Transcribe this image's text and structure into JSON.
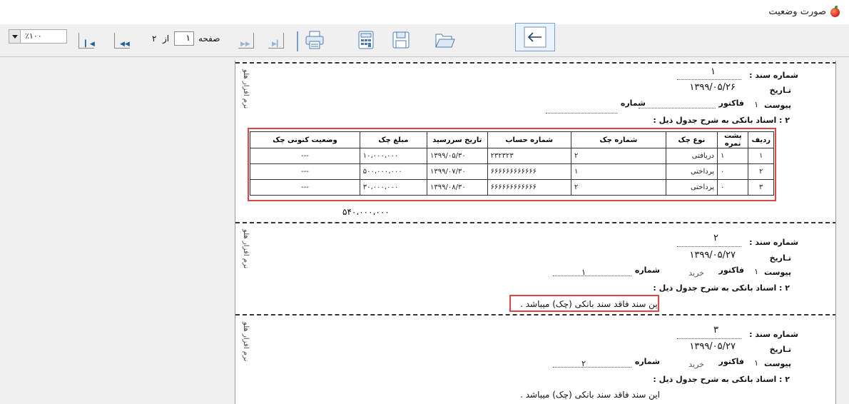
{
  "window": {
    "title": "صورت وضعیت"
  },
  "toolbar": {
    "zoom_value": "٪۱۰۰",
    "page_label": "صفحه",
    "page_current": "۱",
    "page_of": "از",
    "page_total": "۲"
  },
  "side_label": "نرم افزار هلو",
  "labels": {
    "doc_number": "شماره سند :",
    "date": "تـاریخ",
    "attachment": "پیوست",
    "number": "شماره",
    "bank_docs": "۲ : اسناد بانکی به شرح جدول ذیل :",
    "invoice": "فاکتور"
  },
  "documents": [
    {
      "number": "۱",
      "date": "۱۳۹۹/۰۵/۲۶",
      "attachment_index": "۱",
      "invoice_type": "",
      "invoice_number": ""
    },
    {
      "number": "۲",
      "date": "۱۳۹۹/۰۵/۲۷",
      "attachment_index": "۱",
      "invoice_type": "خرید",
      "invoice_number": "۱",
      "note": "این سند فاقد سند بانکی (چک) میباشد ."
    },
    {
      "number": "۳",
      "date": "۱۳۹۹/۰۵/۲۷",
      "attachment_index": "۱",
      "invoice_type": "خرید",
      "invoice_number": "۲",
      "note": "این سند فاقد سند بانکی (چک) میباشد ."
    }
  ],
  "table": {
    "headers": [
      "ردیف",
      "پشت نمره",
      "نوع چک",
      "شماره چک",
      "شماره حساب",
      "تاریخ سررسید",
      "مبلغ چک",
      "وضعیت کنونی چک"
    ],
    "rows": [
      [
        "۱",
        "۱",
        "دریافتی",
        "۲",
        "۲۳۲۳۲۳",
        "۱۳۹۹/۰۵/۳۰",
        "۱۰،۰۰۰،۰۰۰",
        "---"
      ],
      [
        "۲",
        "۰",
        "پرداختی",
        "۱",
        "۶۶۶۶۶۶۶۶۶۶۶۶",
        "۱۳۹۹/۰۷/۳۰",
        "۵۰۰،۰۰۰،۰۰۰",
        "---"
      ],
      [
        "۳",
        "۰",
        "پرداختی",
        "۲",
        "۶۶۶۶۶۶۶۶۶۶۶۶",
        "۱۳۹۹/۰۸/۳۰",
        "۳۰،۰۰۰،۰۰۰",
        "---"
      ]
    ],
    "total": "۵۴۰،۰۰۰،۰۰۰"
  },
  "colors": {
    "highlight": "#e14545",
    "toolbar_icon": "#4a7bb7"
  },
  "icons": [
    "zoom-dropdown-icon",
    "last-page-icon",
    "next-page-icon",
    "previous-page-icon",
    "first-page-icon",
    "print-icon",
    "calculator-icon",
    "save-icon",
    "open-folder-icon",
    "back-arrow-icon",
    "app-icon"
  ]
}
